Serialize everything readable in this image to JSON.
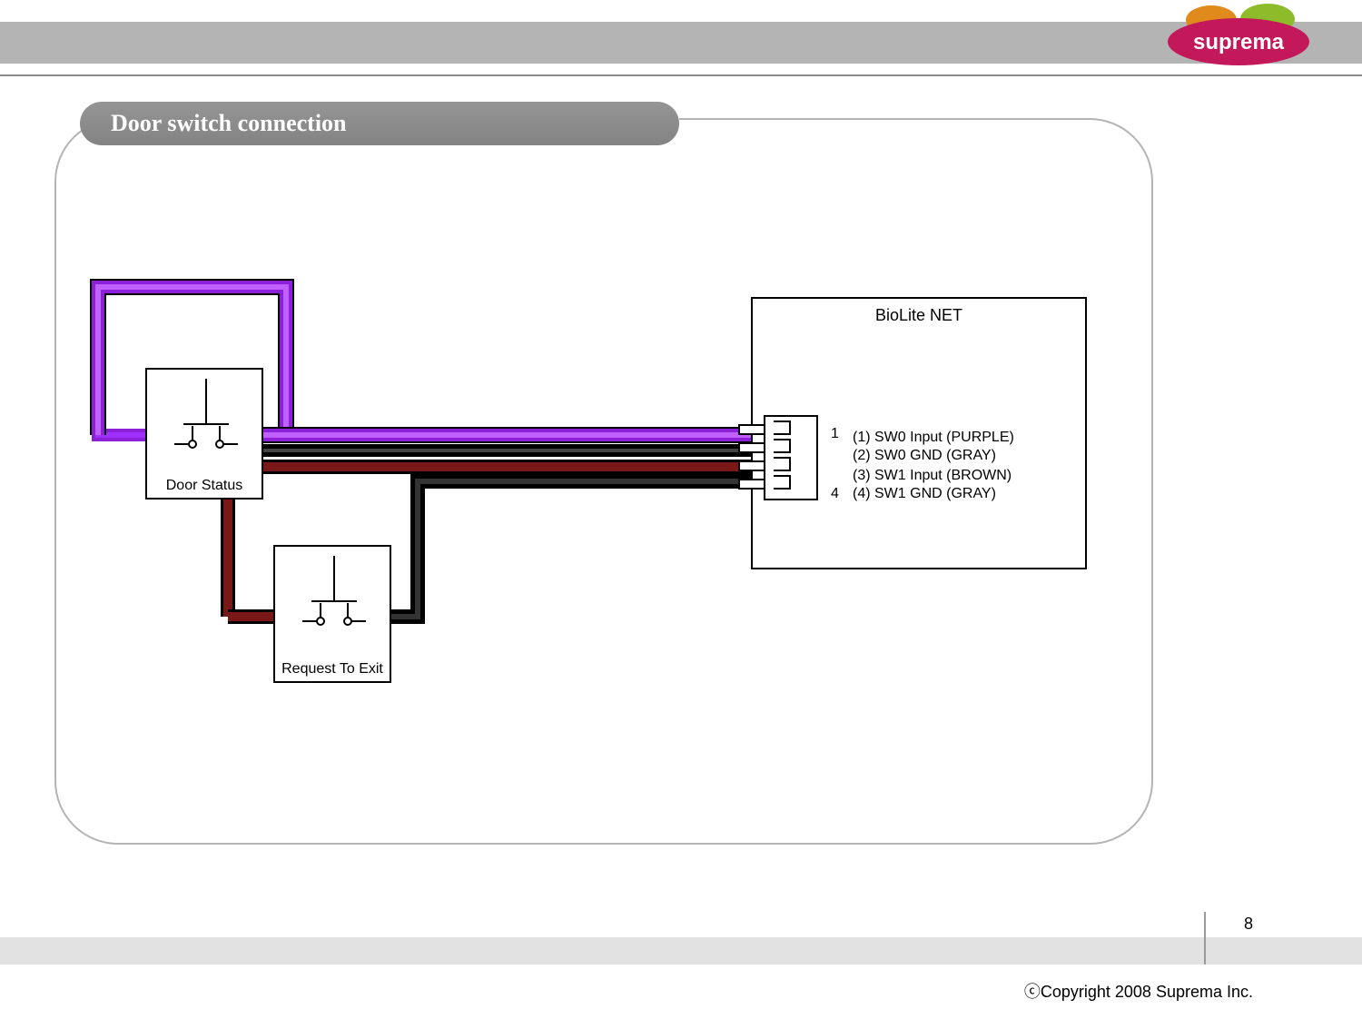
{
  "brand": "suprema",
  "title": "Door switch connection",
  "switch1": {
    "label": "Door Status"
  },
  "switch2": {
    "label": "Request To Exit"
  },
  "device": {
    "title": "BioLite NET",
    "pin_top": "1",
    "pin_bottom": "4",
    "pins": [
      "(1) SW0 Input (PURPLE)",
      "(2) SW0 GND (GRAY)",
      "(3) SW1 Input (BROWN)",
      "(4) SW1 GND (GRAY)"
    ]
  },
  "wires": {
    "purple": {
      "color": "#8c1fd8",
      "desc": "SW0 Input"
    },
    "gray1": {
      "color": "#000000",
      "desc": "SW0 GND"
    },
    "brown": {
      "color": "#7a1818",
      "desc": "SW1 Input"
    },
    "gray2": {
      "color": "#000000",
      "desc": "SW1 GND"
    }
  },
  "page": "8",
  "copyright": "ⓒCopyright 2008 Suprema Inc."
}
